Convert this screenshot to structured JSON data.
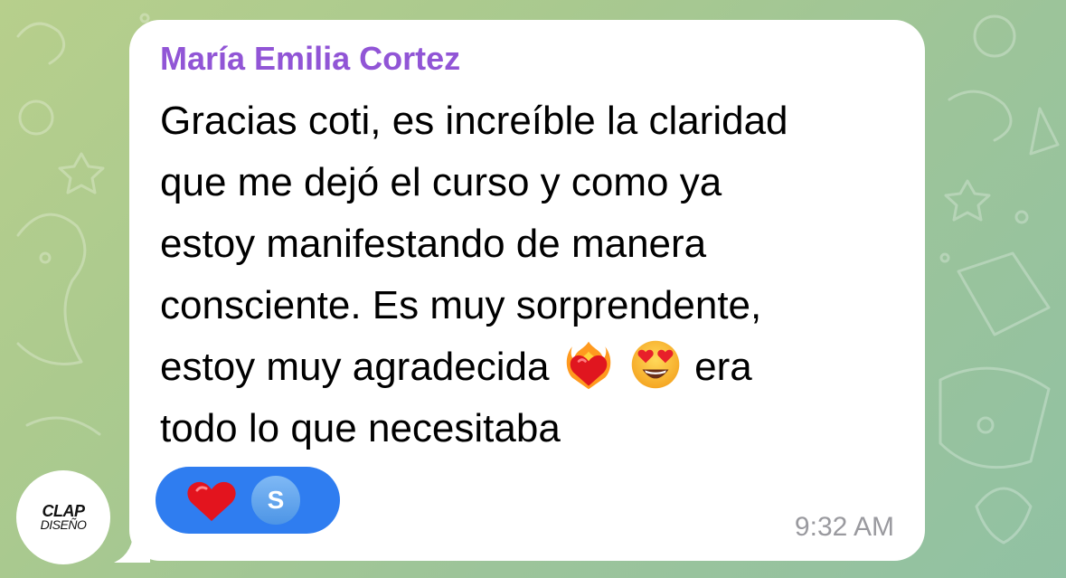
{
  "message": {
    "sender_name": "María Emilia Cortez",
    "lines": [
      "Gracias coti, es increíble la claridad",
      "que me dejó el curso y como ya",
      "estoy manifestando de manera",
      "consciente. Es muy sorprendente,",
      "estoy muy agradecida",
      "todo lo que necesitaba"
    ],
    "line5_after_emojis": "era",
    "inline_emojis": [
      "heart-on-fire-emoji",
      "heart-eyes-emoji"
    ],
    "time": "9:32 AM"
  },
  "reaction": {
    "emoji": "red-heart-emoji",
    "reactor_initial": "S"
  },
  "logo": {
    "main": "CLAP",
    "sub": "DISEÑO"
  },
  "colors": {
    "sender_name": "#9155d6",
    "reaction_pill": "#2f7df0",
    "bubble": "#ffffff",
    "timestamp": "#9a9a9f"
  }
}
